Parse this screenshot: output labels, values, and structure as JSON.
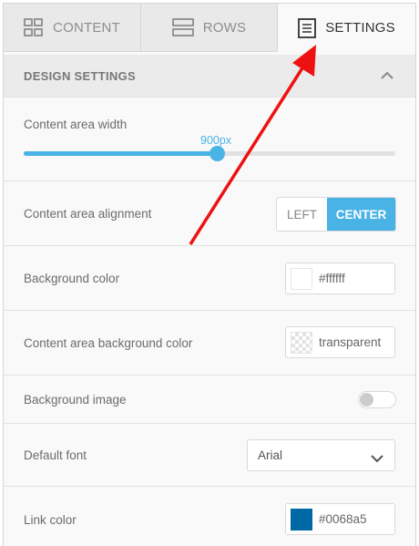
{
  "tabs": [
    {
      "label": "CONTENT",
      "icon": "grid-icon",
      "active": false
    },
    {
      "label": "ROWS",
      "icon": "rows-icon",
      "active": false
    },
    {
      "label": "SETTINGS",
      "icon": "document-icon",
      "active": true
    }
  ],
  "section": {
    "title": "DESIGN SETTINGS",
    "icon": "chevron-up-icon"
  },
  "content_width": {
    "label": "Content area width",
    "value_text": "900px",
    "fill_fraction": 0.52
  },
  "alignment": {
    "label": "Content area alignment",
    "options": [
      "LEFT",
      "CENTER"
    ],
    "selected": "CENTER"
  },
  "background_color": {
    "label": "Background color",
    "value": "#ffffff",
    "swatch": "#ffffff"
  },
  "content_bg_color": {
    "label": "Content area background color",
    "value": "transparent"
  },
  "background_image": {
    "label": "Background image",
    "enabled": false
  },
  "default_font": {
    "label": "Default font",
    "value": "Arial"
  },
  "link_color": {
    "label": "Link color",
    "value": "#0068a5",
    "swatch": "#0068a5"
  },
  "colors": {
    "accent": "#4ab3e6",
    "annotation_arrow": "#ee1111"
  }
}
